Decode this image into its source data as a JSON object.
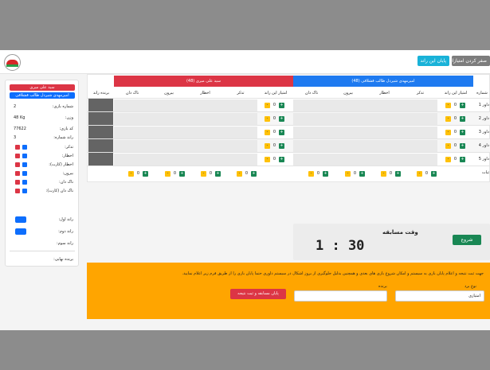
{
  "toolbar": {
    "end_round_label": "پایان این راند",
    "zero_scores_label": "صفر کردن امتیازات"
  },
  "competitors": {
    "red_name": "سید علی میری",
    "blue_name": "امیرمهدی شیردل طالب قشلاقی",
    "red_header": "سید علی میری (48)",
    "blue_header": "امیرمهدی شیردل طالب قشلاقی (48)"
  },
  "sidebar": {
    "rows": [
      {
        "label": "شماره بازی:",
        "value": "2"
      },
      {
        "label": "وزن:",
        "value": "48 Kg"
      },
      {
        "label": "کد بازی:",
        "value": "77622"
      },
      {
        "label": "راند شماره:",
        "value": "3"
      }
    ],
    "counters": [
      "تذکر:",
      "اخطار:",
      "اخطار (کارت):",
      "بیرون:",
      "ناک دان:",
      "ناک دان (کارت):"
    ],
    "round_winners": [
      "راند اول:",
      "راند دوم:",
      "راند سوم:"
    ],
    "final_winner": "برنده نهایی:"
  },
  "table": {
    "col_number": "شماره",
    "col_winner": "برنده راند",
    "columns": [
      "امتیاز این راند",
      "تذکر",
      "اخطار",
      "بیرون",
      "ناک دان"
    ],
    "rounds": [
      "داور 1",
      "داور 2",
      "داور 3",
      "داور 4",
      "داور 5"
    ],
    "stats_label": "ثبات",
    "zero": "0",
    "plus": "+",
    "minus": "-"
  },
  "timer": {
    "label": "وقت مسابقه",
    "value": "1 : 30",
    "start_label": "شروع"
  },
  "result_form": {
    "notice": "جهت ثبت نتیجه و اعلام پایان بازی به سیستم و امکان شروع بازی های بعدی و همچنین بدلیل جلوگیری از بروز اشکال در سیستم داوری حتما پایان بازی را از طریق فرم زیر اعلام نمایید.",
    "win_type_label": "نوع برد",
    "win_type_value": "امتیازی",
    "winner_label": "برنده",
    "winner_value": "",
    "submit_label": "پایان مسابقه و ثبت نتیجه"
  },
  "colors": {
    "red": "#dc3545",
    "blue": "#1e7af0",
    "green": "#198754",
    "yellow": "#ffc107",
    "orange": "#ffa500"
  }
}
